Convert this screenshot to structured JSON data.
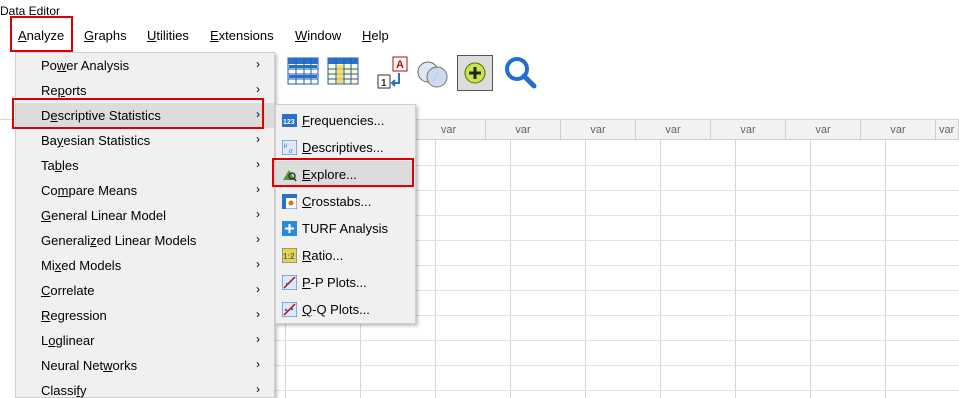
{
  "window": {
    "title": "Data Editor"
  },
  "menubar": [
    {
      "pre": "",
      "u": "A",
      "post": "nalyze"
    },
    {
      "pre": "",
      "u": "G",
      "post": "raphs"
    },
    {
      "pre": "",
      "u": "U",
      "post": "tilities"
    },
    {
      "pre": "",
      "u": "E",
      "post": "xtensions"
    },
    {
      "pre": "",
      "u": "W",
      "post": "indow"
    },
    {
      "pre": "",
      "u": "H",
      "post": "elp"
    }
  ],
  "analyze_menu": [
    {
      "pre": "Po",
      "u": "w",
      "post": "er Analysis",
      "arrow": "›"
    },
    {
      "pre": "Re",
      "u": "p",
      "post": "orts",
      "arrow": "›"
    },
    {
      "pre": "D",
      "u": "e",
      "post": "scriptive Statistics",
      "arrow": "›"
    },
    {
      "pre": "Ba",
      "u": "y",
      "post": "esian Statistics",
      "arrow": "›"
    },
    {
      "pre": "Ta",
      "u": "b",
      "post": "les",
      "arrow": "›"
    },
    {
      "pre": "Co",
      "u": "m",
      "post": "pare Means",
      "arrow": "›"
    },
    {
      "pre": "",
      "u": "G",
      "post": "eneral Linear Model",
      "arrow": "›"
    },
    {
      "pre": "Generali",
      "u": "z",
      "post": "ed Linear Models",
      "arrow": "›"
    },
    {
      "pre": "Mi",
      "u": "x",
      "post": "ed Models",
      "arrow": "›"
    },
    {
      "pre": "",
      "u": "C",
      "post": "orrelate",
      "arrow": "›"
    },
    {
      "pre": "",
      "u": "R",
      "post": "egression",
      "arrow": "›"
    },
    {
      "pre": "L",
      "u": "o",
      "post": "glinear",
      "arrow": "›"
    },
    {
      "pre": "Neural Net",
      "u": "w",
      "post": "orks",
      "arrow": "›"
    },
    {
      "pre": "Classi",
      "u": "f",
      "post": "y",
      "arrow": "›"
    }
  ],
  "descriptive_submenu": [
    {
      "pre": "",
      "u": "F",
      "post": "requencies...",
      "icon": "frequencies-icon"
    },
    {
      "pre": "",
      "u": "D",
      "post": "escriptives...",
      "icon": "descriptives-icon"
    },
    {
      "pre": "",
      "u": "E",
      "post": "xplore...",
      "icon": "explore-icon"
    },
    {
      "pre": "",
      "u": "C",
      "post": "rosstabs...",
      "icon": "crosstabs-icon"
    },
    {
      "pre": "TURF Analysis",
      "u": "",
      "post": "",
      "icon": "turf-icon"
    },
    {
      "pre": "",
      "u": "R",
      "post": "atio...",
      "icon": "ratio-icon"
    },
    {
      "pre": "",
      "u": "P",
      "post": "-P Plots...",
      "icon": "pp-plot-icon"
    },
    {
      "pre": "",
      "u": "Q",
      "post": "-Q Plots...",
      "icon": "qq-plot-icon"
    }
  ],
  "grid": {
    "column_header": "var"
  },
  "colors": {
    "highlight": "#e00000",
    "menu_bg": "#f0f0f0",
    "selected_bg": "#dcdcdc"
  }
}
